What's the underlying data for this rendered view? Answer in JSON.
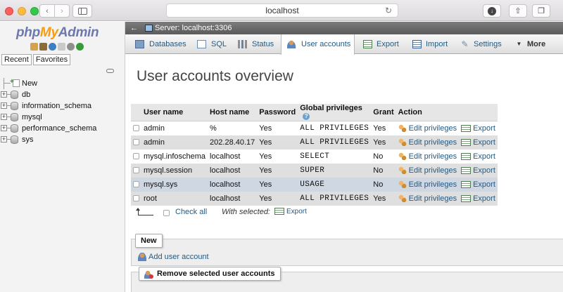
{
  "browser": {
    "address": "localhost",
    "back_glyph": "‹",
    "forward_glyph": "›",
    "reload_glyph": "↻",
    "download_glyph": "↓",
    "share_glyph": "⇧",
    "tabs_glyph": "❐"
  },
  "nav": {
    "logo_part1": "php",
    "logo_part2": "My",
    "logo_part3": "Admin",
    "tabs": [
      "Recent",
      "Favorites"
    ],
    "new_label": "New",
    "databases": [
      "db",
      "information_schema",
      "mysql",
      "performance_schema",
      "sys"
    ]
  },
  "server": {
    "collapse_glyph": "←",
    "label": "Server: localhost:3306"
  },
  "menu": {
    "databases": "Databases",
    "sql": "SQL",
    "status": "Status",
    "user_accounts": "User accounts",
    "export": "Export",
    "import": "Import",
    "settings": "Settings",
    "more": "More"
  },
  "page": {
    "title": "User accounts overview"
  },
  "table": {
    "headers": {
      "user": "User name",
      "host": "Host name",
      "password": "Password",
      "privileges": "Global privileges",
      "grant": "Grant",
      "action": "Action"
    },
    "edit_label": "Edit privileges",
    "export_label": "Export",
    "rows": [
      {
        "user": "admin",
        "host": "%",
        "password": "Yes",
        "privileges": "ALL PRIVILEGES",
        "grant": "Yes"
      },
      {
        "user": "admin",
        "host": "202.28.40.17",
        "password": "Yes",
        "privileges": "ALL PRIVILEGES",
        "grant": "Yes"
      },
      {
        "user": "mysql.infoschema",
        "host": "localhost",
        "password": "Yes",
        "privileges": "SELECT",
        "grant": "No"
      },
      {
        "user": "mysql.session",
        "host": "localhost",
        "password": "Yes",
        "privileges": "SUPER",
        "grant": "No"
      },
      {
        "user": "mysql.sys",
        "host": "localhost",
        "password": "Yes",
        "privileges": "USAGE",
        "grant": "No"
      },
      {
        "user": "root",
        "host": "localhost",
        "password": "Yes",
        "privileges": "ALL PRIVILEGES",
        "grant": "Yes"
      }
    ]
  },
  "footer": {
    "check_all": "Check all",
    "with_selected": "With selected:",
    "export": "Export"
  },
  "new_section": {
    "legend": "New",
    "add_user": "Add user account"
  },
  "remove_section": {
    "legend": "Remove selected user accounts"
  }
}
